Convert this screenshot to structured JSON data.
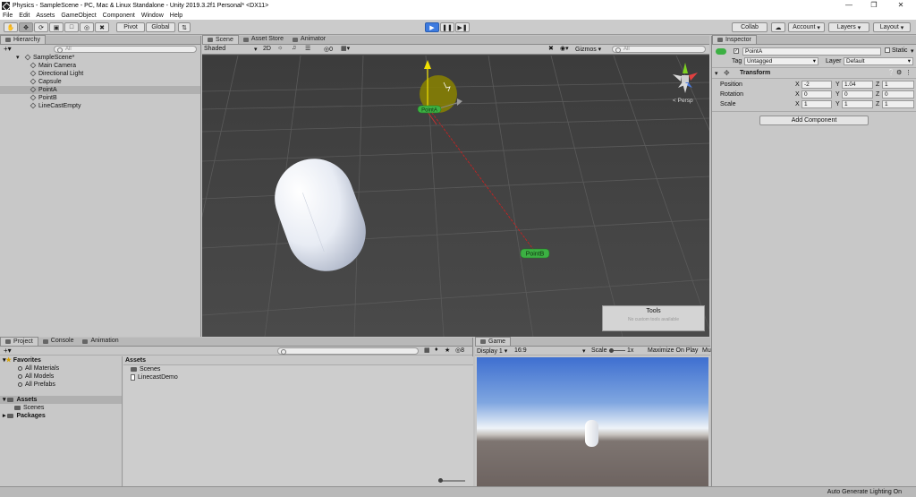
{
  "window": {
    "title": "Physics - SampleScene - PC, Mac & Linux Standalone - Unity 2019.3.2f1 Personal* <DX11>"
  },
  "menu": [
    "File",
    "Edit",
    "Assets",
    "GameObject",
    "Component",
    "Window",
    "Help"
  ],
  "toolbar": {
    "pivot": "Pivot",
    "global": "Global",
    "collab": "Collab",
    "account": "Account",
    "layers": "Layers",
    "layout": "Layout"
  },
  "hierarchy": {
    "tab": "Hierarchy",
    "search_placeholder": "All",
    "scene": "SampleScene*",
    "items": [
      "Main Camera",
      "Directional Light",
      "Capsule",
      "PointA",
      "PointB",
      "LineCastEmpty"
    ]
  },
  "scene": {
    "tabs": [
      "Scene",
      "Asset Store",
      "Animator"
    ],
    "shading": "Shaded",
    "mode2d": "2D",
    "gizmos": "Gizmos",
    "search_placeholder": "All",
    "persp": "Persp",
    "count": "0",
    "label_a": "PointA",
    "label_b": "PointB",
    "tools_title": "Tools",
    "tools_msg": "No custom tools available"
  },
  "inspector": {
    "tab": "Inspector",
    "name": "PointA",
    "static_label": "Static",
    "tag_label": "Tag",
    "tag_value": "Untagged",
    "layer_label": "Layer",
    "layer_value": "Default",
    "component": "Transform",
    "position": {
      "label": "Position",
      "x": "-2",
      "y": "1.04",
      "z": "1"
    },
    "rotation": {
      "label": "Rotation",
      "x": "0",
      "y": "0",
      "z": "0"
    },
    "scale": {
      "label": "Scale",
      "x": "1",
      "y": "1",
      "z": "1"
    },
    "axis_x": "X",
    "axis_y": "Y",
    "axis_z": "Z",
    "add_component": "Add Component"
  },
  "project": {
    "tabs": [
      "Project",
      "Console",
      "Animation"
    ],
    "favorites": "Favorites",
    "fav_items": [
      "All Materials",
      "All Models",
      "All Prefabs"
    ],
    "assets": "Assets",
    "asset_children": [
      "Scenes"
    ],
    "packages": "Packages",
    "breadcrumb": "Assets",
    "files": [
      "Scenes",
      "LinecastDemo"
    ],
    "hidden_count": "8"
  },
  "game": {
    "tab": "Game",
    "display": "Display 1",
    "aspect": "16:9",
    "scale_label": "Scale",
    "scale_value": "1x",
    "maximize": "Maximize On Play",
    "mute": "Mu"
  },
  "status": {
    "text": "Auto Generate Lighting On"
  },
  "colors": {
    "accent": "#3d7be0",
    "point_label": "#3cb043",
    "ray": "#d02020",
    "gizmo_yellow": "#b0a400"
  }
}
